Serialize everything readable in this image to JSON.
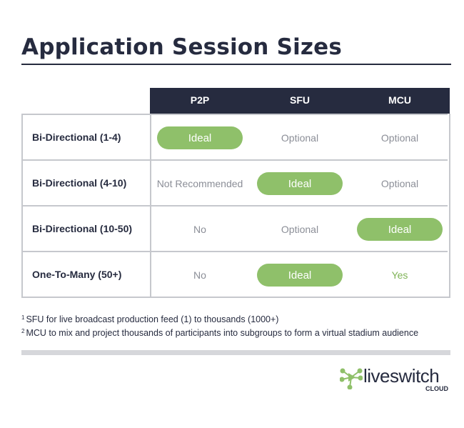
{
  "title": "Application Session Sizes",
  "columns": [
    "P2P",
    "SFU",
    "MCU"
  ],
  "rows": [
    {
      "label": "Bi-Directional (1-4)",
      "cells": [
        {
          "text": "Ideal",
          "style": "pill"
        },
        {
          "text": "Optional",
          "style": "muted"
        },
        {
          "text": "Optional",
          "style": "muted"
        }
      ]
    },
    {
      "label": "Bi-Directional (4-10)",
      "cells": [
        {
          "text": "Not Recommended",
          "style": "muted"
        },
        {
          "text": "Ideal",
          "style": "pill"
        },
        {
          "text": "Optional",
          "style": "muted"
        }
      ]
    },
    {
      "label": "Bi-Directional (10-50)",
      "cells": [
        {
          "text": "No",
          "style": "muted"
        },
        {
          "text": "Optional",
          "style": "muted"
        },
        {
          "text": "Ideal",
          "style": "pill"
        }
      ]
    },
    {
      "label": "One-To-Many (50+)",
      "cells": [
        {
          "text": "No",
          "style": "muted"
        },
        {
          "text": "Ideal",
          "style": "pill"
        },
        {
          "text": "Yes",
          "style": "green"
        }
      ]
    }
  ],
  "footnotes": [
    {
      "mark": "1",
      "text": "SFU for live broadcast production feed (1) to thousands (1000+)"
    },
    {
      "mark": "2",
      "text": "MCU to mix and project thousands of participants into subgroups to form a virtual stadium audience"
    }
  ],
  "logo": {
    "name": "liveswitch",
    "sub": "CLOUD",
    "tm": "™"
  },
  "colors": {
    "navy": "#262b3f",
    "green": "#8fc06a",
    "muted": "#8b8e97",
    "border": "#c6c8cd"
  }
}
